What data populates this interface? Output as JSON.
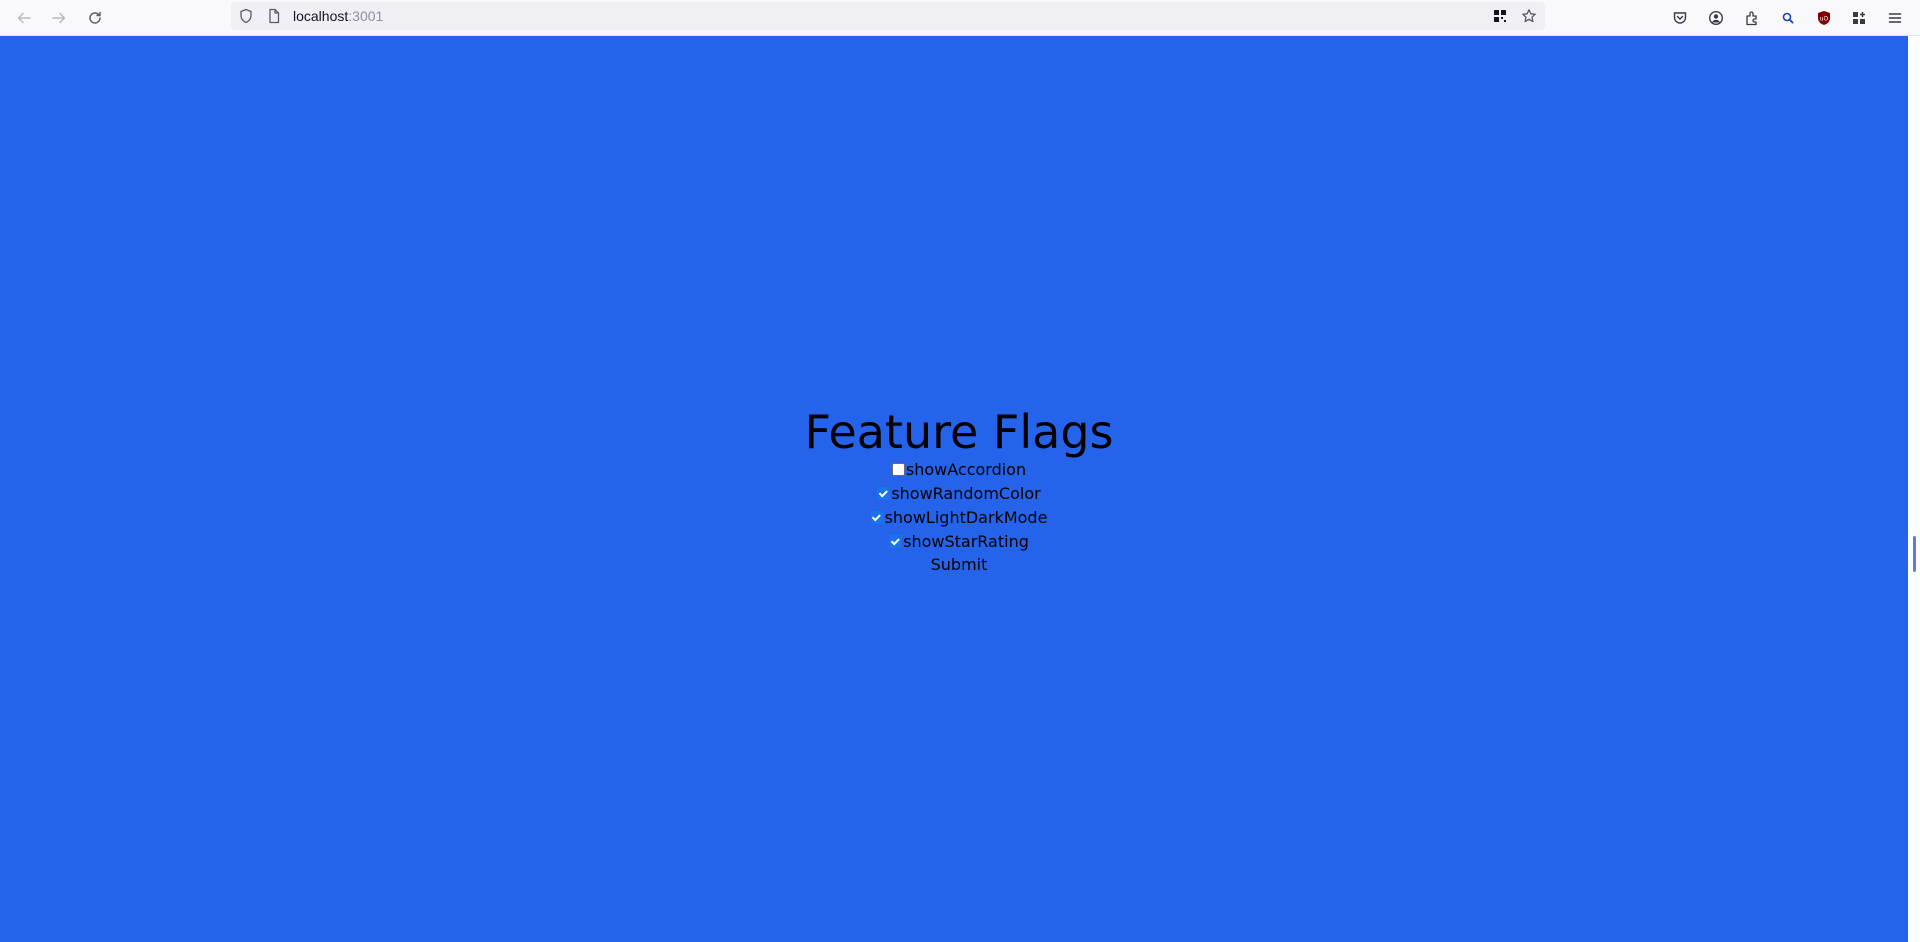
{
  "browser": {
    "url_host": "localhost",
    "url_port": ":3001",
    "icons": {
      "back": "back-arrow-icon",
      "forward": "forward-arrow-icon",
      "reload": "reload-icon",
      "tracking": "shield-icon",
      "page": "page-icon",
      "qr": "qr-code-icon",
      "bookmark": "star-icon",
      "pocket": "pocket-icon",
      "account": "account-icon",
      "extensions": "extensions-icon",
      "search_ext": "search-extension-icon",
      "ublock": "ublock-origin-icon",
      "addons": "addons-grid-icon",
      "menu": "hamburger-menu-icon"
    }
  },
  "page": {
    "background_color": "#2563eb",
    "title": "Feature Flags",
    "flags": [
      {
        "label": "showAccordion",
        "checked": false
      },
      {
        "label": "showRandomColor",
        "checked": true
      },
      {
        "label": "showLightDarkMode",
        "checked": true
      },
      {
        "label": "showStarRating",
        "checked": true
      }
    ],
    "submit_label": "Submit"
  }
}
